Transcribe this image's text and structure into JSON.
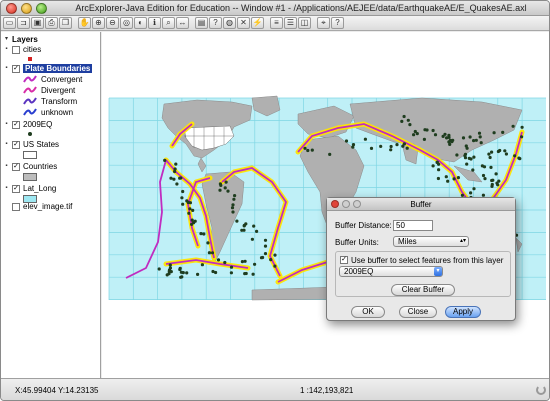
{
  "window": {
    "title": "ArcExplorer-Java Edition for Education -- Window #1 - /Applications/AEJEE/data/EarthquakeAE/E_QuakesAE.axl"
  },
  "toolbar": {
    "tools": [
      "new-icon",
      "open-icon",
      "save-icon",
      "print-icon",
      "copy-icon",
      "sep",
      "hand-icon",
      "zoom-in-icon",
      "zoom-out-icon",
      "full-extent-icon",
      "previous-extent-icon",
      "identify-icon",
      "find-icon",
      "measure-icon",
      "sep",
      "select-icon",
      "query-icon",
      "buffer-icon",
      "clear-select-icon",
      "hyperlink-icon",
      "sep",
      "layer-props-icon",
      "legend-icon",
      "overview-icon",
      "sep",
      "projection-icon",
      "help-icon"
    ]
  },
  "layers": {
    "header": "Layers",
    "items": [
      {
        "name": "cities",
        "checked": false,
        "selected": false
      },
      {
        "name": "Plate Boundaries",
        "checked": true,
        "selected": true
      },
      {
        "name": "2009EQ",
        "checked": true,
        "selected": false
      },
      {
        "name": "US States",
        "checked": true,
        "selected": false
      },
      {
        "name": "Countries",
        "checked": true,
        "selected": false
      },
      {
        "name": "Lat_Long",
        "checked": true,
        "selected": false
      },
      {
        "name": "elev_image.tif",
        "checked": false,
        "selected": false
      }
    ],
    "plate_legend": [
      {
        "label": "Convergent",
        "color": "#c02cc0"
      },
      {
        "label": "Divergent",
        "color": "#d82ea8"
      },
      {
        "label": "Transform",
        "color": "#5a34c0"
      },
      {
        "label": "unknown",
        "color": "#2a3fd0"
      }
    ],
    "colors": {
      "cities": "#d42020",
      "us_states": "#ffffff",
      "countries": "#bdbdbd",
      "lat_long": "#9ee8f2",
      "quake": "#1f3d1f"
    }
  },
  "dialog": {
    "title": "Buffer",
    "distance_label": "Buffer Distance:",
    "distance_value": "50",
    "units_label": "Buffer Units:",
    "units_value": "Miles",
    "use_buffer_label": "Use buffer to select features from this layer",
    "use_buffer_checked": true,
    "layer_value": "2009EQ",
    "clear_label": "Clear Buffer",
    "ok_label": "OK",
    "close_label": "Close",
    "apply_label": "Apply"
  },
  "status": {
    "coordinates": "X:45.99404 Y:14.23135",
    "scale": "1 :142,193,821"
  },
  "map": {
    "ocean_color": "#bff0f7",
    "land_color": "#b0b0b0",
    "us_color": "#ffffff",
    "buffer_color": "#ffe500",
    "plate_color": "#c02cc0",
    "grid_color": "#7fd6e4"
  }
}
